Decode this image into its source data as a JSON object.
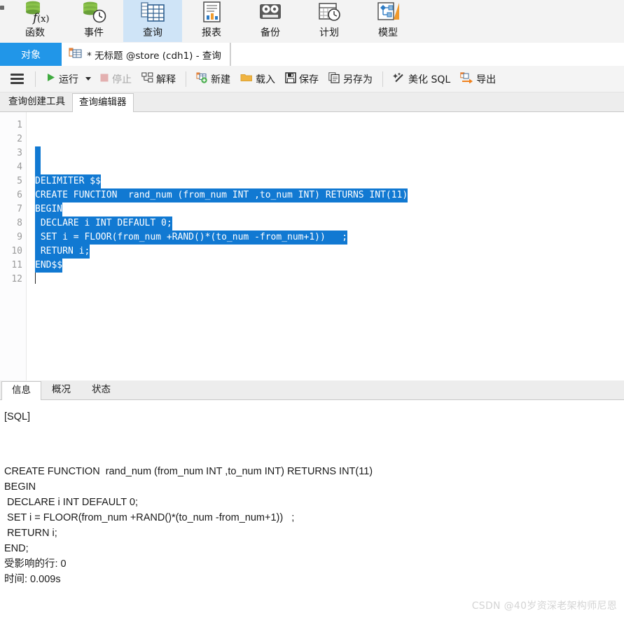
{
  "ribbon": {
    "items": [
      {
        "label": "函数",
        "icon": "function-icon",
        "selected": false
      },
      {
        "label": "事件",
        "icon": "event-clock-icon",
        "selected": false
      },
      {
        "label": "查询",
        "icon": "query-grid-icon",
        "selected": true
      },
      {
        "label": "报表",
        "icon": "report-chart-icon",
        "selected": false
      },
      {
        "label": "备份",
        "icon": "backup-tape-icon",
        "selected": false
      },
      {
        "label": "计划",
        "icon": "schedule-calendar-clock-icon",
        "selected": false
      },
      {
        "label": "模型",
        "icon": "model-diagram-icon",
        "selected": false
      }
    ],
    "selected_bg": "#cfe4f7"
  },
  "tabstrip": {
    "object_tab": "对象",
    "object_tab_bg": "#2196e8",
    "document_tab": "* 无标题 @store (cdh1) - 查询",
    "document_tab_icon": "query-document-icon"
  },
  "toolbar": {
    "menu_icon": "hamburger-menu-icon",
    "run_label": "运行",
    "run_icon": "play-triangle-icon",
    "run_dropdown_icon": "chevron-down-icon",
    "stop_label": "停止",
    "stop_icon": "stop-square-icon",
    "stop_disabled": true,
    "explain_label": "解释",
    "explain_icon": "explain-plan-icon",
    "new_label": "新建",
    "new_icon": "new-query-plus-icon",
    "load_label": "载入",
    "load_icon": "folder-open-icon",
    "save_label": "保存",
    "save_icon": "floppy-disk-icon",
    "save_as_label": "另存为",
    "save_as_icon": "save-as-copy-icon",
    "beautify_label": "美化 SQL",
    "beautify_icon": "magic-wand-icon",
    "export_label": "导出",
    "export_icon": "export-arrow-icon"
  },
  "subtabs": {
    "items": [
      {
        "label": "查询创建工具",
        "active": false
      },
      {
        "label": "查询编辑器",
        "active": true
      }
    ]
  },
  "editor": {
    "line_numbers": [
      "1",
      "2",
      "3",
      "4",
      "5",
      "6",
      "7",
      "8",
      "9",
      "10",
      "11",
      "12"
    ],
    "selection_color": "#1179d2",
    "lines": [
      {
        "n": 1,
        "text": "",
        "sel": "none"
      },
      {
        "n": 2,
        "text": "",
        "sel": "none"
      },
      {
        "n": 3,
        "text": "",
        "sel": "empty"
      },
      {
        "n": 4,
        "text": "",
        "sel": "empty"
      },
      {
        "n": 5,
        "text": "DELIMITER $$",
        "sel": "full"
      },
      {
        "n": 6,
        "text": "CREATE FUNCTION  rand_num (from_num INT ,to_num INT) RETURNS INT(11)",
        "sel": "full"
      },
      {
        "n": 7,
        "text": "BEGIN",
        "sel": "full"
      },
      {
        "n": 8,
        "text": " DECLARE i INT DEFAULT 0;",
        "sel": "full"
      },
      {
        "n": 9,
        "text": " SET i = FLOOR(from_num +RAND()*(to_num -from_num+1))   ;",
        "sel": "full"
      },
      {
        "n": 10,
        "text": " RETURN i;",
        "sel": "full"
      },
      {
        "n": 11,
        "text": "END$$",
        "sel": "full"
      },
      {
        "n": 12,
        "text": "",
        "sel": "caret"
      }
    ]
  },
  "result_tabs": {
    "items": [
      {
        "label": "信息",
        "active": true
      },
      {
        "label": "概况",
        "active": false
      },
      {
        "label": "状态",
        "active": false
      }
    ]
  },
  "output": {
    "header": "[SQL]",
    "lines": [
      "CREATE FUNCTION  rand_num (from_num INT ,to_num INT) RETURNS INT(11)",
      "BEGIN",
      " DECLARE i INT DEFAULT 0;",
      " SET i = FLOOR(from_num +RAND()*(to_num -from_num+1))   ;",
      " RETURN i;",
      "END;",
      "受影响的行: 0",
      "时间: 0.009s"
    ]
  },
  "watermark": "CSDN @40岁资深老架构师尼恩"
}
